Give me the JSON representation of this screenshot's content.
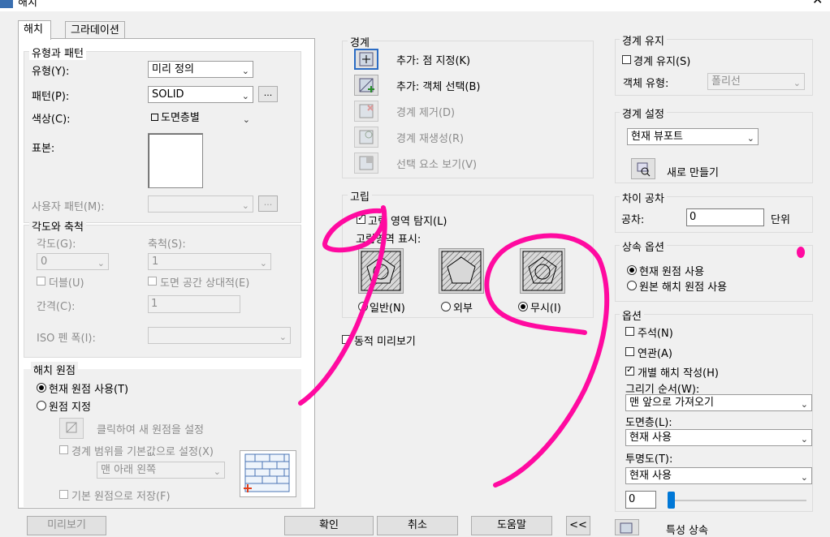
{
  "window": {
    "title": "해치"
  },
  "tabs": [
    {
      "label": "해치"
    },
    {
      "label": "그라데이션"
    }
  ],
  "type_pattern": {
    "title": "유형과 패턴",
    "type_label": "유형(Y):",
    "type_value": "미리 정의",
    "pattern_label": "패턴(P):",
    "pattern_value": "SOLID",
    "browse": "...",
    "color_label": "색상(C):",
    "color_value": "도면층별",
    "sample_label": "표본:",
    "custom_label": "사용자 패턴(M):",
    "custom_browse": "..."
  },
  "angle_scale": {
    "title": "각도와 축척",
    "angle_label": "각도(G):",
    "angle_value": "0",
    "scale_label": "축척(S):",
    "scale_value": "1",
    "double_label": "더블(U)",
    "paper_label": "도면 공간 상대적(E)",
    "spacing_label": "간격(C):",
    "spacing_value": "1",
    "iso_label": "ISO 펜 폭(I):"
  },
  "origin": {
    "title": "해치 원점",
    "use_current": "현재 원점 사용(T)",
    "specified": "원점 지정",
    "click_set": "클릭하여 새 원점을 설정",
    "default_boundary": "경계 범위를 기본값으로 설정(X)",
    "position_value": "맨 아래 왼쪽",
    "store_default": "기본 원점으로 저장(F)"
  },
  "boundaries": {
    "title": "경계",
    "add_pick": "추가: 점 지정(K)",
    "add_select": "추가: 객체 선택(B)",
    "remove": "경계 제거(D)",
    "recreate": "경계 재생성(R)",
    "view": "선택 요소 보기(V)"
  },
  "islands": {
    "title": "고립",
    "detect": "고립 영역 탐지(L)",
    "display_label": "고립영역 표시:",
    "normal": "일반(N)",
    "outer": "외부",
    "ignore": "무시(I)",
    "selected": "ignore"
  },
  "preview_label": "동적 미리보기",
  "retain": {
    "title": "경계 유지",
    "retain_label": "경계 유지(S)",
    "object_type_label": "객체 유형:",
    "object_type_value": "폴리선"
  },
  "boundary_set": {
    "title": "경계 설정",
    "value": "현재 뷰포트",
    "new_label": "새로 만들기"
  },
  "gap": {
    "title": "차이 공차",
    "tolerance_label": "공차:",
    "tolerance_value": "0",
    "unit_label": "단위"
  },
  "inherit": {
    "title": "상속 옵션",
    "use_current": "현재 원점 사용",
    "use_source": "원본 해치 원점 사용"
  },
  "options": {
    "title": "옵션",
    "annotative": "주석(N)",
    "associative": "연관(A)",
    "separate": "개별 해치 작성(H)",
    "draw_order_label": "그리기 순서(W):",
    "draw_order_value": "맨 앞으로 가져오기",
    "layer_label": "도면층(L):",
    "layer_value": "현재 사용",
    "transparency_label": "투명도(T):",
    "transparency_value": "현재 사용",
    "transparency_number": "0"
  },
  "footer": {
    "preview": "미리보기",
    "ok": "확인",
    "cancel": "취소",
    "help": "도움말",
    "collapse": "<<",
    "inherit_props": "특성 상속"
  },
  "colors": {
    "annotation": "#ff0aa0",
    "slider": "#0078d7"
  }
}
